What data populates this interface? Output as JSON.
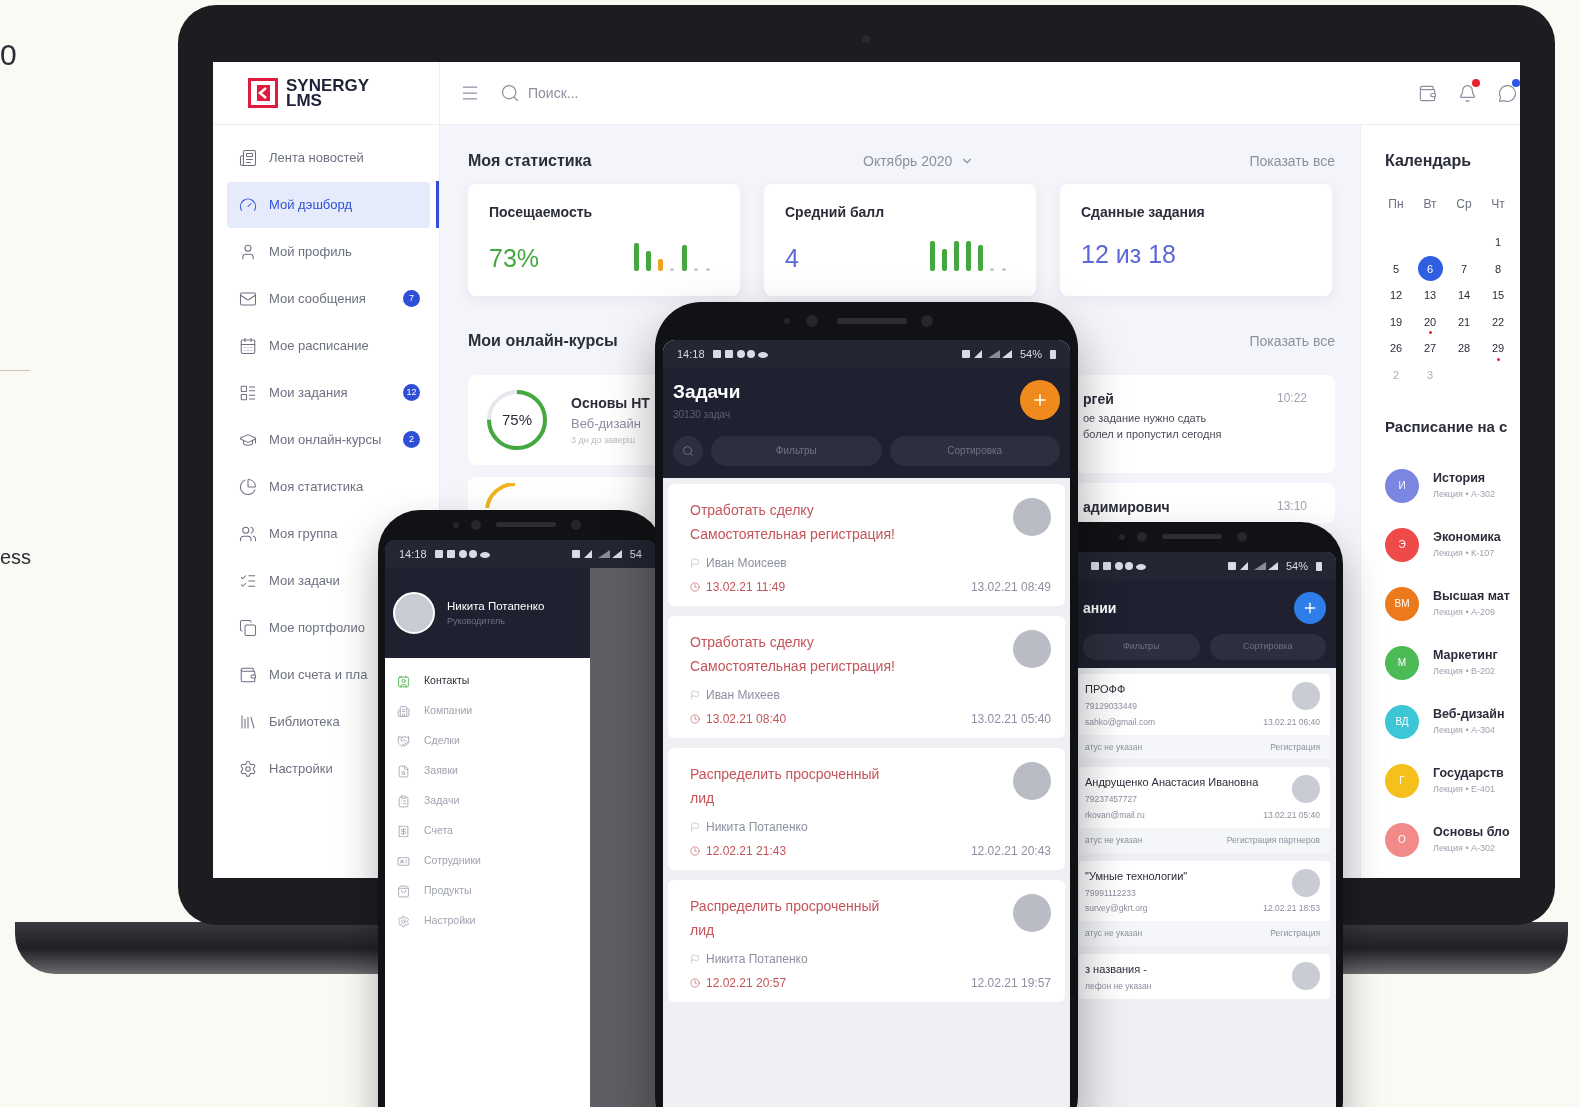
{
  "backdrop_texts": [
    "0",
    "ess"
  ],
  "laptop": {
    "logo": {
      "line1": "SYNERGY",
      "line2": "LMS"
    },
    "search": {
      "placeholder": "Поиск..."
    },
    "header_icons": [
      {
        "dot": false
      },
      {
        "dot": true,
        "color": "#e8202e"
      },
      {
        "dot": true,
        "color": "#2a55e5"
      }
    ],
    "sidebar": {
      "items": [
        {
          "label": "Лента новостей",
          "selected": false
        },
        {
          "label": "Мой дэшборд",
          "selected": true
        },
        {
          "label": "Мой профиль",
          "selected": false
        },
        {
          "label": "Мои сообщения",
          "selected": false,
          "badge": "7"
        },
        {
          "label": "Мое расписание",
          "selected": false
        },
        {
          "label": "Мои задания",
          "selected": false,
          "badge": "12"
        },
        {
          "label": "Мои онлайн-курсы",
          "selected": false,
          "badge": "2"
        },
        {
          "label": "Моя статистика",
          "selected": false
        },
        {
          "label": "Моя группа",
          "selected": false
        },
        {
          "label": "Мои задачи",
          "selected": false
        },
        {
          "label": "Мое портфолио",
          "selected": false
        },
        {
          "label": "Мои счета и пла",
          "selected": false
        },
        {
          "label": "Библиотека",
          "selected": false
        },
        {
          "label": "Настройки",
          "selected": false
        }
      ]
    },
    "stats": {
      "title": "Моя статистика",
      "period": "Октябрь 2020",
      "show_all": "Показать все",
      "cards": [
        {
          "title": "Посещаемость",
          "value": "73%",
          "color": "#43a83f"
        },
        {
          "title": "Средний балл",
          "value": "4",
          "color": "#5b68d6"
        },
        {
          "title": "Сданные задания",
          "value": "12 из 18",
          "color": "#5b68d6"
        }
      ]
    },
    "courses": {
      "title": "Мои онлайн-курсы",
      "show_all": "Показать все",
      "cards": [
        {
          "progress": "75%",
          "level": 0.75,
          "title": "Основы HT",
          "subtitle": "Веб-дизайн",
          "note": "3 дн до заверш"
        }
      ]
    },
    "messages": [
      {
        "name": "ргей",
        "time": "10:22",
        "lines": [
          "ое задание нужно сдать",
          "болел и пропустил сегодня"
        ]
      },
      {
        "name": "адимирович",
        "time": "13:10"
      }
    ],
    "calendar": {
      "title": "Календарь",
      "weekdays": [
        "Пн",
        "Вт",
        "Ср",
        "Чт"
      ],
      "weeks": [
        [
          {
            "day": "1",
            "selected": false,
            "event": false,
            "other_month": false
          }
        ],
        [
          {
            "day": "5",
            "selected": false,
            "event": false,
            "other_month": false
          },
          {
            "day": "6",
            "selected": true,
            "event": false,
            "other_month": false
          },
          {
            "day": "7",
            "selected": false,
            "event": false,
            "other_month": false
          },
          {
            "day": "8",
            "selected": false,
            "event": false,
            "other_month": false
          }
        ],
        [
          {
            "day": "12",
            "selected": false,
            "event": false,
            "other_month": false
          },
          {
            "day": "13",
            "selected": false,
            "event": false,
            "other_month": false
          },
          {
            "day": "14",
            "selected": false,
            "event": false,
            "other_month": false
          },
          {
            "day": "15",
            "selected": false,
            "event": false,
            "other_month": false
          }
        ],
        [
          {
            "day": "19",
            "selected": false,
            "event": false,
            "other_month": false
          },
          {
            "day": "20",
            "selected": false,
            "event": true,
            "other_month": false
          },
          {
            "day": "21",
            "selected": false,
            "event": false,
            "other_month": false
          },
          {
            "day": "22",
            "selected": false,
            "event": false,
            "other_month": false
          }
        ],
        [
          {
            "day": "26",
            "selected": false,
            "event": false,
            "other_month": false
          },
          {
            "day": "27",
            "selected": false,
            "event": false,
            "other_month": false
          },
          {
            "day": "28",
            "selected": false,
            "event": false,
            "other_month": false
          },
          {
            "day": "29",
            "selected": false,
            "event": true,
            "other_month": false
          }
        ],
        [
          {
            "day": "2",
            "selected": false,
            "event": false,
            "other_month": true
          },
          {
            "day": "3",
            "selected": false,
            "event": false,
            "other_month": true
          }
        ]
      ]
    },
    "schedule": {
      "title": "Расписание на с",
      "items": [
        {
          "initials": "И",
          "color": "#7b86e0",
          "subject": "История",
          "details": "Лекция • А-302"
        },
        {
          "initials": "Э",
          "color": "#ee4a4a",
          "subject": "Экономика",
          "details": "Лекция • К-107"
        },
        {
          "initials": "ВМ",
          "color": "#ec7a1c",
          "subject": "Высшая мат",
          "details": "Лекция • А-209"
        },
        {
          "initials": "М",
          "color": "#4cbb55",
          "subject": "Маркетинг",
          "details": "Лекция • В-202"
        },
        {
          "initials": "ВД",
          "color": "#3cc6d6",
          "subject": "Веб-дизайн",
          "details": "Лекция • А-304"
        },
        {
          "initials": "Г",
          "color": "#f5c01c",
          "subject": "Государств",
          "details": "Лекция • Е-401"
        },
        {
          "initials": "О",
          "color": "#f28a8a",
          "subject": "Основы бло",
          "details": "Лекция • А-302"
        }
      ]
    }
  },
  "left_phone": {
    "time": "14:18",
    "battery": "54",
    "user": {
      "name": "Никита Потапенко",
      "role": "Руководитель"
    },
    "menu": [
      {
        "label": "Контакты",
        "selected": true
      },
      {
        "label": "Компании",
        "selected": false
      },
      {
        "label": "Сделки",
        "selected": false
      },
      {
        "label": "Заявки",
        "selected": false
      },
      {
        "label": "Задачи",
        "selected": false
      },
      {
        "label": "Счета",
        "selected": false
      },
      {
        "label": "Сотрудники",
        "selected": false
      },
      {
        "label": "Продукты",
        "selected": false
      },
      {
        "label": "Настройки",
        "selected": false
      }
    ]
  },
  "center_phone": {
    "time": "14:18",
    "battery": "54%",
    "title": "Задачи",
    "subtitle": "30130 задач",
    "buttons": [
      "Фильтры",
      "Сортировка"
    ],
    "tasks": [
      {
        "title": "Отработать сделку Самостоятельная регистрация!",
        "person": "Иван Моисеев",
        "deadline": "13.02.21 11:49",
        "created": "13.02.21 08:49"
      },
      {
        "title": "Отработать сделку Самостоятельная регистрация!",
        "person": "Иван Михеев",
        "deadline": "13.02.21 08:40",
        "created": "13.02.21 05:40"
      },
      {
        "title": "Распределить просроченный лид",
        "person": "Никита Потапенко",
        "deadline": "12.02.21 21:43",
        "created": "12.02.21 20:43"
      },
      {
        "title": "Распределить просроченный лид",
        "person": "Никита Потапенко",
        "deadline": "12.02.21 20:57",
        "created": "12.02.21 19:57"
      }
    ]
  },
  "right_phone": {
    "battery": "54%",
    "title": "ании",
    "buttons": [
      "Фильтры",
      "Сортировка"
    ],
    "leads": [
      {
        "name": "ПРОФФ",
        "phone": "79129033449",
        "email": "sahko@gmail.com",
        "date": "13.02.21 06:40",
        "status": "атус не указан",
        "tag": "Регистрация"
      },
      {
        "name": "Андрущенко Анастасия Ивановна",
        "phone": "79237457727",
        "email": "rkovan@mail.ru",
        "date": "13.02.21 05:40",
        "status": "атус не указан",
        "tag": "Регистрация партнеров"
      },
      {
        "name": "\"Умные технологии\"",
        "phone": "79991112233",
        "email": "survey@gkrt.org",
        "date": "12.02.21 18:53",
        "status": "атус не указан",
        "tag": "Регистрация"
      },
      {
        "name": "з названия -",
        "phone": "лефон не указан"
      }
    ]
  }
}
